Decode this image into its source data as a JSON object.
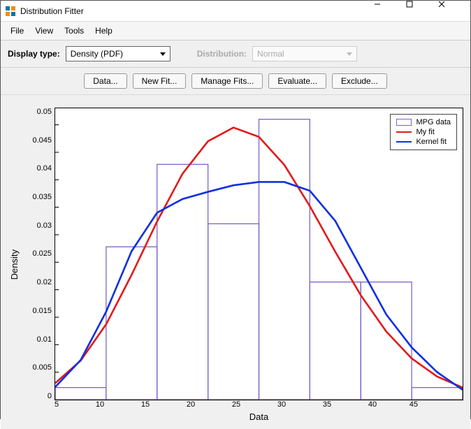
{
  "window": {
    "title": "Distribution Fitter"
  },
  "menu": {
    "file": "File",
    "view": "View",
    "tools": "Tools",
    "help": "Help"
  },
  "toolbar": {
    "display_label": "Display type:",
    "display_value": "Density (PDF)",
    "distribution_label": "Distribution:",
    "distribution_value": "Normal"
  },
  "buttons": {
    "data": "Data...",
    "newfit": "New Fit...",
    "manage": "Manage Fits...",
    "evaluate": "Evaluate...",
    "exclude": "Exclude..."
  },
  "legend": {
    "mpg": "MPG data",
    "myfit": "My fit",
    "kernel": "Kernel fit"
  },
  "axes": {
    "xlabel": "Data",
    "ylabel": "Density"
  },
  "chart_data": {
    "type": "bar+line",
    "xlabel": "Data",
    "ylabel": "Density",
    "xlim": [
      5,
      45
    ],
    "ylim": [
      0,
      0.053
    ],
    "xticks": [
      5,
      10,
      15,
      20,
      25,
      30,
      35,
      40,
      45
    ],
    "yticks": [
      0,
      0.005,
      0.01,
      0.015,
      0.02,
      0.025,
      0.03,
      0.035,
      0.04,
      0.045,
      0.05
    ],
    "histogram": {
      "name": "MPG data",
      "bin_edges": [
        5,
        10,
        15,
        20,
        25,
        30,
        35,
        40,
        45
      ],
      "densities": [
        0.0022,
        0.0278,
        0.0428,
        0.032,
        0.051,
        0.0214,
        0.0214,
        0.0022
      ]
    },
    "series": [
      {
        "name": "My fit",
        "color": "#e21a1a",
        "x": [
          5,
          7.5,
          10,
          12.5,
          15,
          17.5,
          20,
          22.5,
          25,
          27.5,
          30,
          32.5,
          35,
          37.5,
          40,
          42.5,
          45
        ],
        "y": [
          0.003,
          0.0071,
          0.0137,
          0.0227,
          0.0324,
          0.0411,
          0.047,
          0.0495,
          0.0478,
          0.0427,
          0.0352,
          0.0269,
          0.019,
          0.0124,
          0.0075,
          0.0042,
          0.0022
        ]
      },
      {
        "name": "Kernel fit",
        "color": "#1030e0",
        "x": [
          5,
          7.5,
          10,
          12.5,
          15,
          17.5,
          20,
          22.5,
          25,
          27.5,
          30,
          32.5,
          35,
          37.5,
          40,
          42.5,
          45
        ],
        "y": [
          0.0023,
          0.0072,
          0.016,
          0.027,
          0.034,
          0.0365,
          0.0378,
          0.039,
          0.0396,
          0.0396,
          0.038,
          0.0325,
          0.024,
          0.0155,
          0.0095,
          0.005,
          0.0018
        ]
      }
    ]
  }
}
